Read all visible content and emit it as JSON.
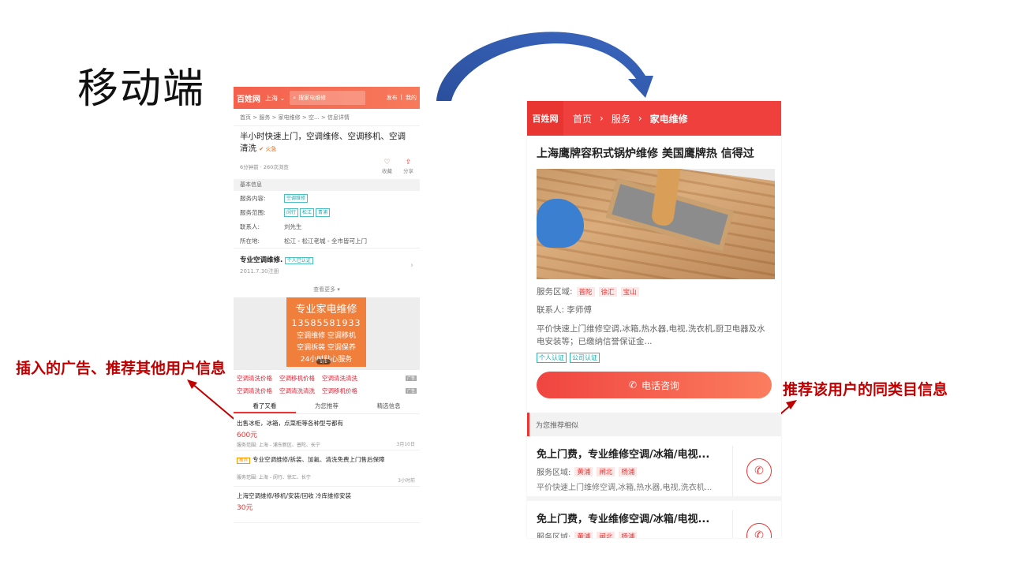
{
  "slide": {
    "title": "移动端",
    "annot_left": "插入的广告、推荐其他用户信息",
    "annot_right": "推荐该用户的同类目信息"
  },
  "left_phone": {
    "logo": "百姓网",
    "city": "上海",
    "search_placeholder": "搜家电维修",
    "publish": "发布",
    "mine": "我的",
    "breadcrumb": "首页 > 服务 > 家电维修 > 空... > 信息详情",
    "title": "半小时快速上门，空调维修、空调移机、空调清洗",
    "fire_tag": "火急",
    "meta": "6分钟前 · 260次浏览",
    "favorite": "收藏",
    "share": "分享",
    "section_basic": "基本信息",
    "content_label": "服务内容:",
    "content_tags": [
      "空调维修"
    ],
    "range_label": "服务范围:",
    "range_tags": [
      "闵行",
      "松江",
      "青浦"
    ],
    "contact_label": "联系人:",
    "contact_value": "刘先生",
    "location_label": "所在地:",
    "location_value": "松江 - 松江老城 - 全市皆可上门",
    "user_name": "专业空调维修.",
    "user_verified": "个人已认证",
    "user_date": "2011.7.30注册",
    "see_more": "查看更多",
    "ad": {
      "title": "专业家电维修",
      "phone": "13585581933",
      "line1": "空调维修 空调移机",
      "line2": "空调拆装 空调保养",
      "line3": "24小时贴心服务",
      "page": "1/1"
    },
    "links": [
      [
        "空调清洗价格",
        "空调移机价格",
        "空调清洗清洗"
      ],
      [
        "空调清洗价格",
        "空调清洗清洗",
        "空调移机价格"
      ]
    ],
    "ad_tag": "广告",
    "tabs": [
      "看了又看",
      "为您推荐",
      "精选信息"
    ],
    "items": [
      {
        "title": "出售冰柜，冰箱，点菜柜等各种型号都有",
        "price": "600元",
        "area": "服务范围: 上海 - 浦东新区、普陀、长宁",
        "time": "3月10日",
        "badge": ""
      },
      {
        "title": "专业空调维修/拆装、加氟、清洗免费上门售后保障",
        "price": "",
        "area": "服务范围: 上海 - 闵行、徐汇、长宁",
        "time": "3小时前",
        "badge": "推荐"
      },
      {
        "title": "上海空调维修/移机/安装/回收 冷库维修安装",
        "price": "30元",
        "area": "",
        "time": "",
        "badge": ""
      }
    ]
  },
  "right_phone": {
    "logo": "百姓网",
    "breadcrumb": [
      "首页",
      "服务",
      "家电维修"
    ],
    "title": "上海鹰牌容积式锅炉维修 美国鹰牌热 信得过",
    "area_label": "服务区域:",
    "area_tags": [
      "普陀",
      "徐汇",
      "宝山"
    ],
    "contact": "联系人:  李师傅",
    "desc": "平价快速上门维修空调,冰箱,热水器,电视,洗衣机,厨卫电器及水电安装等；已缴纳信誉保证金...",
    "verify": [
      "个人认证",
      "公司认证"
    ],
    "call": "电话咨询",
    "rec_header": "为您推荐相似",
    "recs": [
      {
        "title": "免上门费，专业维修空调/冰箱/电视...",
        "area_label": "服务区域:",
        "tags": [
          "黄浦",
          "闸北",
          "杨浦"
        ],
        "desc": "平价快速上门维修空调,冰箱,热水器,电视,洗衣机..."
      },
      {
        "title": "免上门费，专业维修空调/冰箱/电视...",
        "area_label": "服务区域:",
        "tags": [
          "黄浦",
          "闸北",
          "杨浦"
        ],
        "desc": ""
      }
    ]
  },
  "colors": {
    "accent": "#f0403d",
    "annotation": "#c00000",
    "arrow": "#2e55a6"
  }
}
